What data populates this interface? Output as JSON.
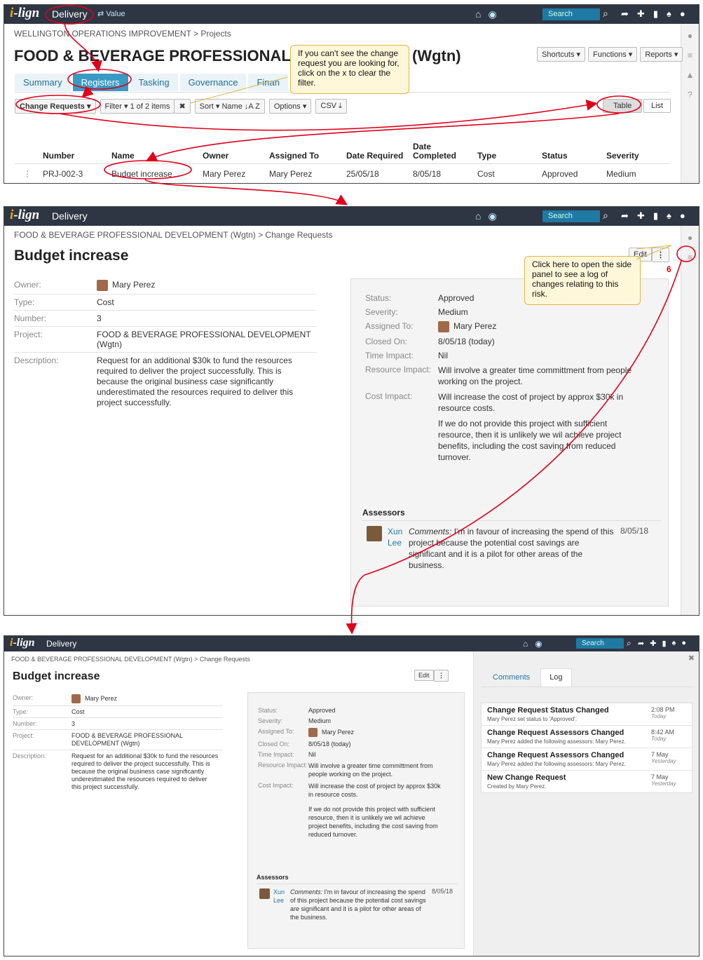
{
  "app": {
    "logo_i": "i",
    "logo_rest": "-lign",
    "nav_delivery": "Delivery",
    "nav_value": "⇄ Value",
    "search_placeholder": "Search"
  },
  "p1": {
    "breadcrumb": "WELLINGTON OPERATIONS IMPROVEMENT > Projects",
    "title_left": "FOOD & BEVERAGE PROFESSIONAL",
    "title_right": "(Wgtn)",
    "tabs": [
      "Summary",
      "Registers",
      "Tasking",
      "Governance",
      "Finan"
    ],
    "buttons": {
      "shortcuts": "Shortcuts ▾",
      "functions": "Functions ▾",
      "reports": "Reports ▾"
    },
    "toolbar": {
      "change_requests": "Change Requests ▾",
      "filter": "Filter ▾   1 of 2 items",
      "clear": "✖",
      "sort": "Sort ▾   Name ↓A Z",
      "options": "Options ▾",
      "csv": "CSV ⤓",
      "table": "Table",
      "list": "List"
    },
    "table": {
      "headers": [
        "Number",
        "Name",
        "Owner",
        "Assigned To",
        "Date Required",
        "Date Completed",
        "Type",
        "Status",
        "Severity"
      ],
      "row": [
        "PRJ-002-3",
        "Budget increase",
        "Mary Perez",
        "Mary Perez",
        "25/05/18",
        "8/05/18",
        "Cost",
        "Approved",
        "Medium"
      ]
    },
    "callout": "If you can't see the change request you are looking for, click on the x to clear the filter."
  },
  "detail": {
    "breadcrumb": "FOOD & BEVERAGE PROFESSIONAL DEVELOPMENT (Wgtn) > Change Requests",
    "title": "Budget increase",
    "edit": "Edit",
    "more": "⋮",
    "fields": [
      {
        "label": "Owner:",
        "value": "Mary Perez"
      },
      {
        "label": "Type:",
        "value": "Cost"
      },
      {
        "label": "Number:",
        "value": "3"
      },
      {
        "label": "Project:",
        "value": "FOOD & BEVERAGE PROFESSIONAL DEVELOPMENT (Wgtn)"
      },
      {
        "label": "Description:",
        "value": "Request for an additional $30k to fund the resources required to deliver the project successfully. This is because the original business case significantly underestimated the resources required to deliver this project successfully."
      }
    ],
    "info": [
      {
        "label": "Status:",
        "value": "Approved"
      },
      {
        "label": "Severity:",
        "value": "Medium"
      },
      {
        "label": "Assigned To:",
        "value": "Mary Perez"
      },
      {
        "label": "Closed On:",
        "value": "8/05/18 (today)"
      },
      {
        "label": "Time Impact:",
        "value": "Nil"
      },
      {
        "label": "Resource Impact:",
        "value": "Will involve a greater time committment from people working on the project."
      },
      {
        "label": "Cost Impact:",
        "value": "Will increase the cost of project by approx $30k in resource costs."
      }
    ],
    "extra": "If we do not provide this project with sufficient resource, then it is unlikely we wil achieve project benefits, including the cost saving from reduced turnover.",
    "assessors_heading": "Assessors",
    "assessor_name": "Xun Lee",
    "assessor_label": "Comments:",
    "assessor_comment": "I'm in favour of increasing the spend of this project because the potential cost savings are significant and it is a pilot for other areas of the business.",
    "assessor_date": "8/05/18",
    "callout": "Click here to open the side panel to see a log of changes relating to this risk.",
    "step": "6"
  },
  "side": {
    "tabs": [
      "Comments",
      "Log"
    ],
    "close": "✖",
    "log": [
      {
        "title": "Change Request Status Changed",
        "desc": "Mary Perez set status to 'Approved'.",
        "time": "2:08 PM",
        "day": "Today"
      },
      {
        "title": "Change Request Assessors Changed",
        "desc": "Mary Perez added the following assessors: Mary Perez.",
        "time": "8:42 AM",
        "day": "Today"
      },
      {
        "title": "Change Request Assessors Changed",
        "desc": "Mary Perez added the following assessors: Mary Perez.",
        "time": "7 May",
        "day": "Yesterday"
      },
      {
        "title": "New Change Request",
        "desc": "Created by Mary Perez.",
        "time": "7 May",
        "day": "Yesterday"
      }
    ]
  },
  "colors": {
    "topbar": "#2e3543",
    "accent": "#3a9ac4",
    "link": "#1f7aa3",
    "annotation": "#e0001a",
    "callout": "#fff7d9"
  }
}
